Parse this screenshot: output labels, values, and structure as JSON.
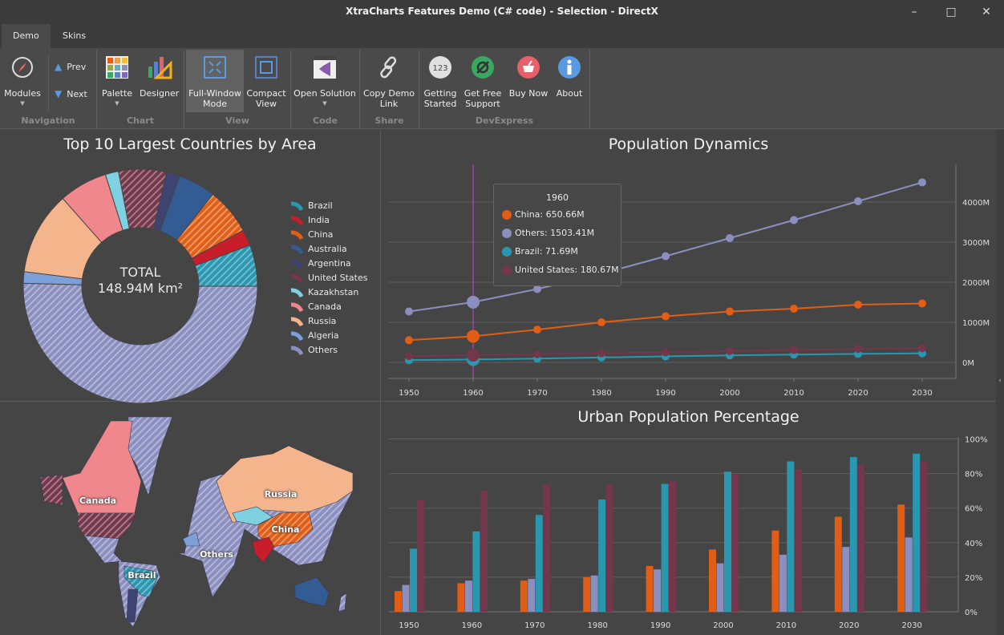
{
  "window": {
    "title": "XtraCharts Features Demo (C# code) - Selection - DirectX"
  },
  "tabs": [
    {
      "label": "Demo",
      "active": true
    },
    {
      "label": "Skins",
      "active": false
    }
  ],
  "ribbon": {
    "buttons": [
      {
        "id": "modules",
        "label": "Modules",
        "icon": "compass-icon"
      },
      {
        "id": "prev",
        "label": "Prev",
        "icon": "triangle-up-icon"
      },
      {
        "id": "next",
        "label": "Next",
        "icon": "triangle-down-icon"
      },
      {
        "id": "palette",
        "label": "Palette",
        "icon": "palette-grid-icon"
      },
      {
        "id": "designer",
        "label": "Designer",
        "icon": "chart-designer-icon"
      },
      {
        "id": "fullwindow",
        "label": "Full-Window Mode",
        "icon": "expand-icon",
        "active": true
      },
      {
        "id": "compact",
        "label": "Compact View",
        "icon": "compact-view-icon"
      },
      {
        "id": "opensolution",
        "label": "Open Solution",
        "icon": "visual-studio-icon"
      },
      {
        "id": "copylink",
        "label": "Copy Demo Link",
        "icon": "link-icon"
      },
      {
        "id": "getstarted",
        "label": "Getting Started",
        "icon": "123-icon"
      },
      {
        "id": "support",
        "label": "Get Free Support",
        "icon": "support-icon"
      },
      {
        "id": "buynow",
        "label": "Buy Now",
        "icon": "cart-icon"
      },
      {
        "id": "about",
        "label": "About",
        "icon": "info-icon"
      }
    ],
    "groups": [
      "Navigation",
      "Chart",
      "View",
      "Code",
      "Share",
      "DevExpress"
    ]
  },
  "donut": {
    "title": "Top 10 Largest Countries by Area",
    "center_line1": "TOTAL",
    "center_line2": "148.94M km²"
  },
  "map": {
    "labels": [
      "Canada",
      "Russia",
      "China",
      "Others",
      "Brazil"
    ]
  },
  "line": {
    "title": "Population Dynamics",
    "tooltip": {
      "header": "1960",
      "rows": [
        "China: 650.66M",
        "Others: 1503.41M",
        "Brazil: 71.69M",
        "United States: 180.67M"
      ]
    }
  },
  "bar": {
    "title": "Urban Population Percentage"
  },
  "chart_data": [
    {
      "type": "pie",
      "title": "Top 10 Largest Countries by Area",
      "unit": "M km²",
      "hole": true,
      "categories": [
        "Brazil",
        "India",
        "China",
        "Australia",
        "Argentina",
        "United States",
        "Kazakhstan",
        "Canada",
        "Russia",
        "Algeria",
        "Others"
      ],
      "values": [
        8.52,
        3.29,
        9.6,
        7.69,
        2.78,
        9.83,
        2.72,
        9.98,
        17.1,
        2.38,
        75.05
      ],
      "colors": [
        "#2a97b0",
        "#c81d2a",
        "#e05e16",
        "#335c94",
        "#3d4472",
        "#73364a",
        "#7fd0e0",
        "#f0878c",
        "#f4b48c",
        "#7ea0d8",
        "#8b8fc0"
      ],
      "hatched": [
        true,
        false,
        true,
        false,
        false,
        true,
        false,
        false,
        false,
        false,
        true
      ],
      "legend": "right"
    },
    {
      "type": "line",
      "title": "Population Dynamics",
      "x": [
        1950,
        1960,
        1970,
        1980,
        1990,
        2000,
        2010,
        2020,
        2030
      ],
      "series": [
        {
          "name": "China",
          "color": "#e05e16",
          "values": [
            554,
            650.66,
            818,
            1000,
            1150,
            1270,
            1340,
            1440,
            1470
          ]
        },
        {
          "name": "Others",
          "color": "#8b8fc0",
          "values": [
            1270,
            1503.41,
            1830,
            2210,
            2650,
            3100,
            3550,
            4020,
            4490
          ]
        },
        {
          "name": "Brazil",
          "color": "#2a97b0",
          "values": [
            54,
            71.69,
            95,
            122,
            150,
            175,
            195,
            213,
            225
          ]
        },
        {
          "name": "United States",
          "color": "#73364a",
          "values": [
            158,
            180.67,
            205,
            230,
            250,
            282,
            309,
            335,
            355
          ]
        }
      ],
      "yticks": [
        "0M",
        "1000M",
        "2000M",
        "3000M",
        "4000M"
      ],
      "ylim": [
        -400,
        4900
      ],
      "grid": true,
      "crosshair_x": 1960
    },
    {
      "type": "bar",
      "title": "Urban Population Percentage",
      "categories": [
        "1950",
        "1960",
        "1970",
        "1980",
        "1990",
        "2000",
        "2010",
        "2020",
        "2030"
      ],
      "series": [
        {
          "name": "China",
          "color": "#e05e16",
          "values": [
            12,
            16.5,
            18,
            20,
            26.5,
            36,
            47,
            55,
            62
          ]
        },
        {
          "name": "Others",
          "color": "#8b8fc0",
          "values": [
            15.5,
            18,
            19,
            21,
            24.5,
            28,
            33,
            37.5,
            43
          ]
        },
        {
          "name": "Brazil",
          "color": "#2a97b0",
          "values": [
            36.5,
            46.5,
            56,
            65,
            74,
            81,
            87,
            89.5,
            91.5
          ]
        },
        {
          "name": "United States",
          "color": "#73364a",
          "values": [
            64.5,
            70,
            73.5,
            73.5,
            75.5,
            79.5,
            82.5,
            85,
            87
          ]
        }
      ],
      "yticks": [
        "0%",
        "20%",
        "40%",
        "60%",
        "80%",
        "100%"
      ],
      "ylim": [
        0,
        100
      ],
      "grid": true
    }
  ]
}
